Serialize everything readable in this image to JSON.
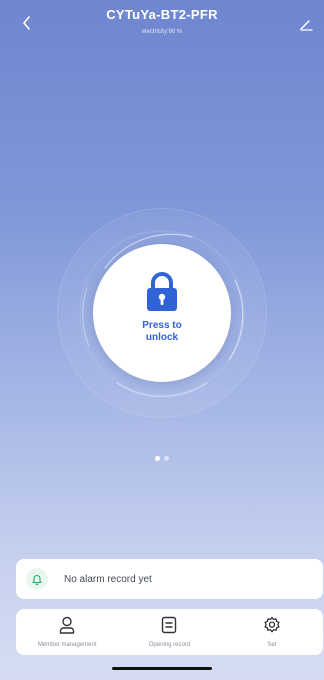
{
  "header": {
    "title": "CYTuYa-BT2-PFR",
    "subtitle": "electricity:90 %"
  },
  "lock": {
    "label_line1": "Press to",
    "label_line2": "unlock",
    "accent": "#2f63d6"
  },
  "pager": {
    "active_index": 0,
    "count": 2
  },
  "alarm": {
    "text": "No alarm record yet",
    "icon": "bell-icon",
    "icon_color": "#2aa866"
  },
  "nav": {
    "items": [
      {
        "label": "Member management",
        "icon": "person-icon"
      },
      {
        "label": "Opening record",
        "icon": "document-icon"
      },
      {
        "label": "Set",
        "icon": "gear-icon"
      }
    ]
  }
}
